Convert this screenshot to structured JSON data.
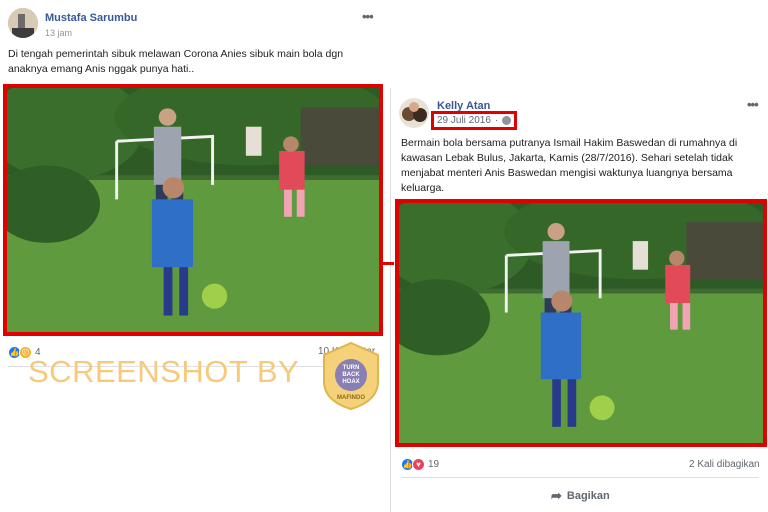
{
  "left_post": {
    "author": "Mustafa Sarumbu",
    "time": "13 jam",
    "more": "•••",
    "text": "Di tengah pemerintah sibuk melawan Corona Anies sibuk main bola dgn anaknya emang Anis nggak punya hati..",
    "reaction_count": "4",
    "comments_partial": "10 Komentar"
  },
  "right_post": {
    "author": "Kelly Atan",
    "date": "29 Juli 2016",
    "more": "•••",
    "text": "Bermain bola bersama putranya Ismail Hakim Baswedan di rumahnya di kawasan Lebak Bulus, Jakarta, Kamis (28/7/2016). Sehari setelah tidak menjabat menteri Anis Baswedan mengisi waktunya luangnya bersama keluarga.",
    "reaction_count": "19",
    "shares": "2 Kali dibagikan",
    "share_button": "Bagikan"
  },
  "watermark": {
    "text": "SCREENSHOT BY",
    "badge_top": "TURN BACK HOAX",
    "badge_bottom": "MAFINDO"
  },
  "colors": {
    "highlight": "#e10000",
    "link": "#385898",
    "watermark": "#f7c97a"
  }
}
